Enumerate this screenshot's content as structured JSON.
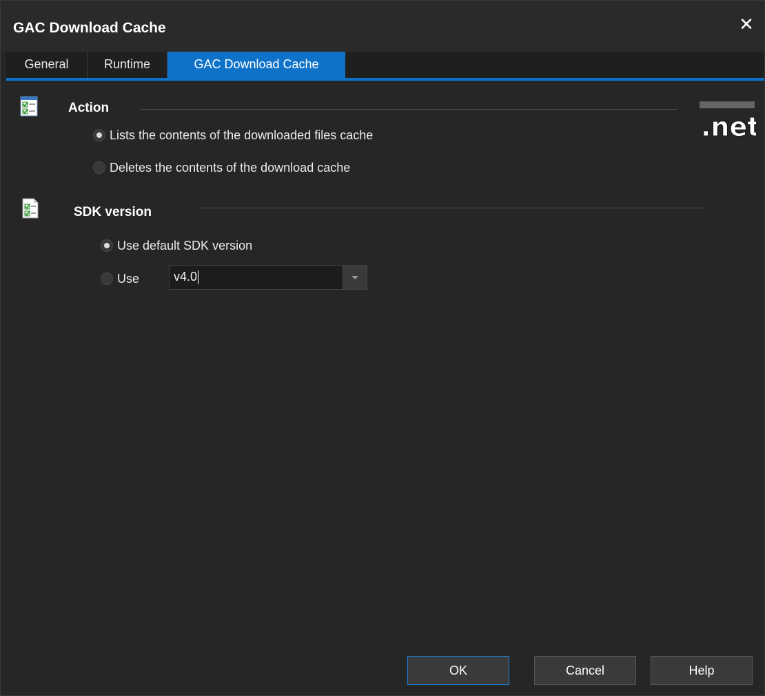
{
  "window": {
    "title": "GAC Download Cache"
  },
  "tabs": [
    {
      "label": "General",
      "active": false
    },
    {
      "label": "Runtime",
      "active": false
    },
    {
      "label": "GAC Download Cache",
      "active": true
    }
  ],
  "action": {
    "title": "Action",
    "options": [
      {
        "label": "Lists the contents of the downloaded files cache",
        "selected": true
      },
      {
        "label": "Deletes the contents of the download cache",
        "selected": false
      }
    ]
  },
  "sdk": {
    "title": "SDK version",
    "options": [
      {
        "label": "Use default SDK version",
        "selected": true
      },
      {
        "label": "Use",
        "selected": false
      }
    ],
    "version_value": "v4.0"
  },
  "logo": {
    "text": ".net"
  },
  "buttons": {
    "ok": "OK",
    "cancel": "Cancel",
    "help": "Help"
  },
  "colors": {
    "accent": "#0e72c9",
    "background": "#262626",
    "titlebar": "#2a2a2a"
  }
}
